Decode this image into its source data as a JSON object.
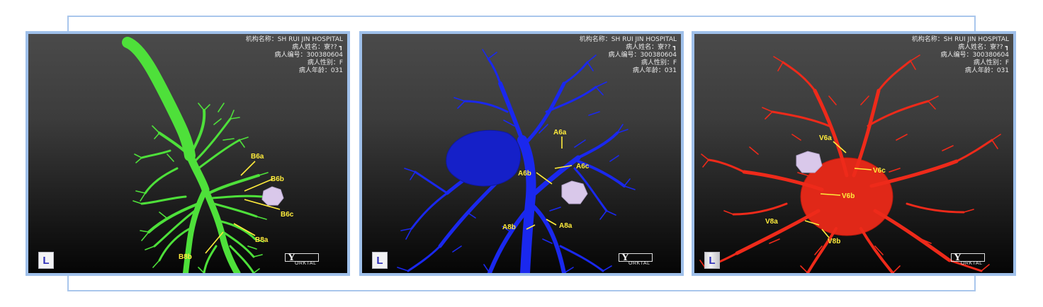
{
  "patient_info": {
    "institution": "机构名称：SH RUI JIN HOSPITAL",
    "name": "病人姓名：寮?? ┓",
    "id": "病人编号：300380604",
    "sex": "病人性别：F",
    "age": "病人年龄：031"
  },
  "orientation_label": "L",
  "logo": {
    "mark": "Y",
    "text": "ORKTAL"
  },
  "panels": [
    {
      "id": "bronchi",
      "color": "#4ee03a",
      "labels": [
        "B6a",
        "B6b",
        "B6c",
        "B8a",
        "B8b"
      ]
    },
    {
      "id": "arteries",
      "color": "#1a28ee",
      "labels": [
        "A6a",
        "A6c",
        "A6b",
        "A8b",
        "A8a"
      ]
    },
    {
      "id": "veins",
      "color": "#ee2a1a",
      "labels": [
        "V6a",
        "V6c",
        "V6b",
        "V8a",
        "V8b"
      ]
    }
  ],
  "colors": {
    "annotation": "#ffec3c",
    "nodule": "#d9c8ea",
    "frame": "#9fc0ea"
  }
}
